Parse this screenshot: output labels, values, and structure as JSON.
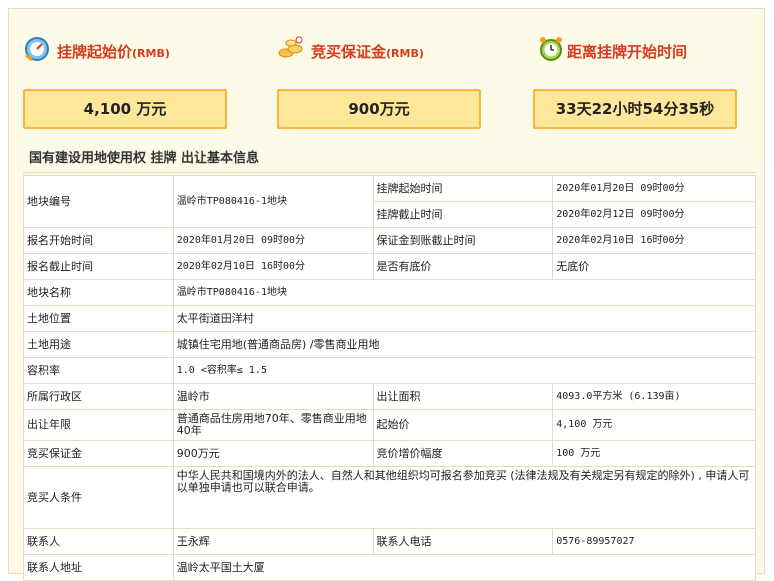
{
  "cards": [
    {
      "icon": "gauge-icon",
      "title": "挂牌起始价",
      "unit_tag": "(RMB)",
      "value": "4,100 万元"
    },
    {
      "icon": "coins-icon",
      "title": "竞买保证金",
      "unit_tag": "(RMB)",
      "value": "900万元"
    },
    {
      "icon": "alarm-clock-icon",
      "title": "距离挂牌开始时间",
      "unit_tag": "",
      "value": "33天22小时54分35秒"
    }
  ],
  "section_title": "国有建设用地使用权 挂牌 出让基本信息",
  "table": {
    "parcel_no_label": "地块编号",
    "parcel_no": "温岭市TP080416-1地块",
    "listing_start_label": "挂牌起始时间",
    "listing_start": "2020年01月20日 09时00分",
    "listing_end_label": "挂牌截止时间",
    "listing_end": "2020年02月12日 09时00分",
    "reg_start_label": "报名开始时间",
    "reg_start": "2020年01月20日 09时00分",
    "deposit_deadline_label": "保证金到账截止时间",
    "deposit_deadline": "2020年02月10日 16时00分",
    "reg_end_label": "报名截止时间",
    "reg_end": "2020年02月10日 16时00分",
    "reserve_label": "是否有底价",
    "reserve": "无底价",
    "parcel_name_label": "地块名称",
    "parcel_name": "温岭市TP080416-1地块",
    "location_label": "土地位置",
    "location": "太平街道田洋村",
    "usage_label": "土地用途",
    "usage": "城镇住宅用地(普通商品房) /零售商业用地",
    "far_label": "容积率",
    "far": "1.0 <容积率≤ 1.5",
    "district_label": "所属行政区",
    "district": "温岭市",
    "area_label": "出让面积",
    "area": "4093.0平方米 (6.139亩)",
    "term_label": "出让年限",
    "term": "普通商品住房用地70年、零售商业用地40年",
    "start_price_label": "起始价",
    "start_price": "4,100 万元",
    "bid_deposit_label": "竞买保证金",
    "bid_deposit": "900万元",
    "increment_label": "竞价增价幅度",
    "increment": "100 万元",
    "bidder_cond_label": "竞买人条件",
    "bidder_cond": "中华人民共和国境内外的法人、自然人和其他组织均可报名参加竞买 (法律法规及有关规定另有规定的除外) , 申请人可以单独申请也可以联合申请。",
    "contact_label": "联系人",
    "contact": "王永辉",
    "phone_label": "联系人电话",
    "phone": "0576-89957027",
    "address_label": "联系人地址",
    "address": "温岭太平国土大厦"
  },
  "colors": {
    "accent": "#d73a1f",
    "box_border": "#f6b53e",
    "box_fill": "#ffe79a",
    "panel_bg": "#fdfbe8"
  }
}
